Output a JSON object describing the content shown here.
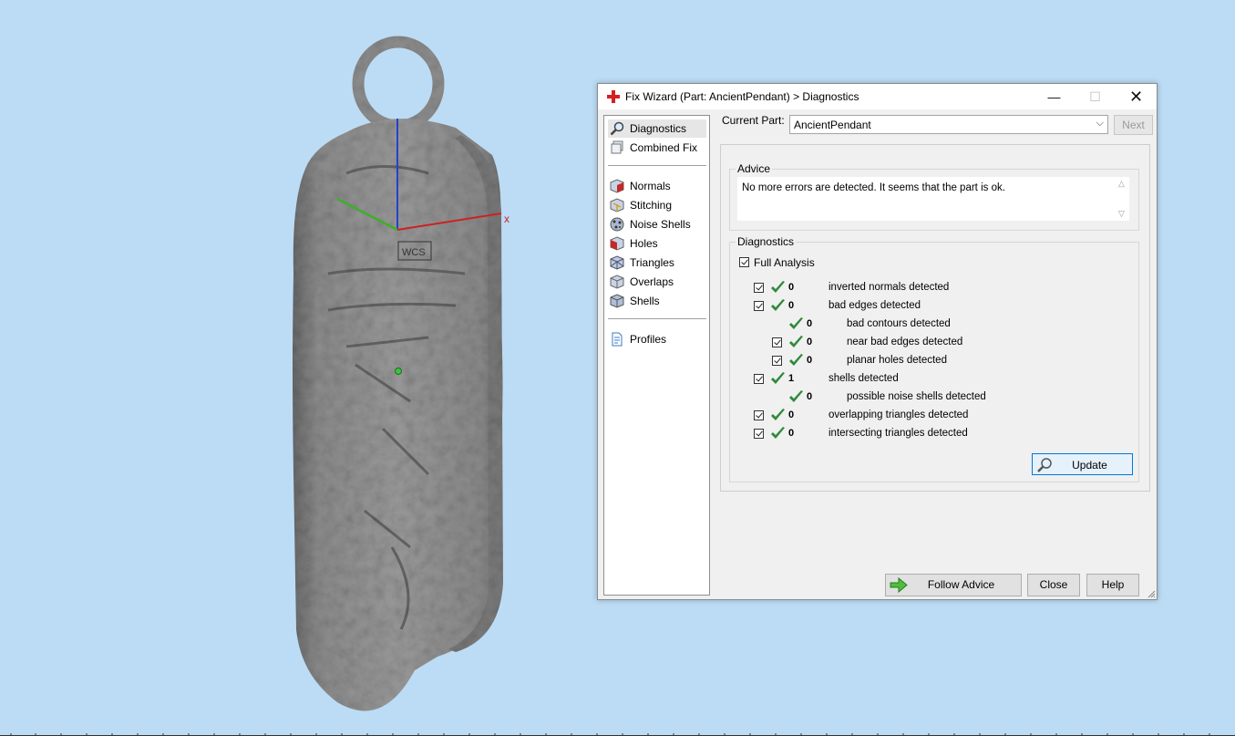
{
  "viewport": {
    "background": "#bcdcf5",
    "axis_x_label": "x",
    "wcs_label": "WCS",
    "axis_colors": {
      "x": "#cc2222",
      "y": "#3fae2a",
      "z": "#2244cc"
    }
  },
  "dialog": {
    "title": "Fix Wizard (Part: AncientPendant) > Diagnostics",
    "window_buttons": {
      "minimize": "—",
      "maximize": "☐",
      "close": "✕"
    },
    "nav": {
      "group1": [
        {
          "label": "Diagnostics",
          "icon": "magnifier-icon",
          "selected": true
        },
        {
          "label": "Combined Fix",
          "icon": "cube-stack-icon"
        }
      ],
      "group2": [
        {
          "label": "Normals",
          "icon": "cube-normals-icon"
        },
        {
          "label": "Stitching",
          "icon": "cube-stitch-icon"
        },
        {
          "label": "Noise Shells",
          "icon": "noise-shells-icon"
        },
        {
          "label": "Holes",
          "icon": "cube-holes-icon"
        },
        {
          "label": "Triangles",
          "icon": "cube-triangles-icon"
        },
        {
          "label": "Overlaps",
          "icon": "cube-overlaps-icon"
        },
        {
          "label": "Shells",
          "icon": "cube-shells-icon"
        }
      ],
      "group3": [
        {
          "label": "Profiles",
          "icon": "document-icon"
        }
      ]
    },
    "current_part": {
      "label": "Current Part:",
      "value": "AncientPendant",
      "next_label": "Next"
    },
    "advice": {
      "title": "Advice",
      "text": "No more errors are detected. It seems that the part is ok."
    },
    "diagnostics": {
      "title": "Diagnostics",
      "full_analysis_label": "Full Analysis",
      "full_analysis_checked": true,
      "rows": [
        {
          "count": "0",
          "text": "inverted normals detected",
          "has_checkbox": true,
          "indent": 0
        },
        {
          "count": "0",
          "text": "bad edges detected",
          "has_checkbox": true,
          "indent": 0
        },
        {
          "count": "0",
          "text": "bad contours detected",
          "has_checkbox": false,
          "indent": 1
        },
        {
          "count": "0",
          "text": "near bad edges detected",
          "has_checkbox": true,
          "indent": 1
        },
        {
          "count": "0",
          "text": "planar holes detected",
          "has_checkbox": true,
          "indent": 1
        },
        {
          "count": "1",
          "text": "shells detected",
          "has_checkbox": true,
          "indent": 0
        },
        {
          "count": "0",
          "text": "possible noise shells detected",
          "has_checkbox": false,
          "indent": 1
        },
        {
          "count": "0",
          "text": "overlapping triangles detected",
          "has_checkbox": true,
          "indent": 0
        },
        {
          "count": "0",
          "text": "intersecting triangles detected",
          "has_checkbox": true,
          "indent": 0
        }
      ],
      "update_label": "Update",
      "check_color": "#2f8a3c"
    },
    "buttons": {
      "follow_advice": "Follow Advice",
      "close": "Close",
      "help": "Help"
    }
  }
}
